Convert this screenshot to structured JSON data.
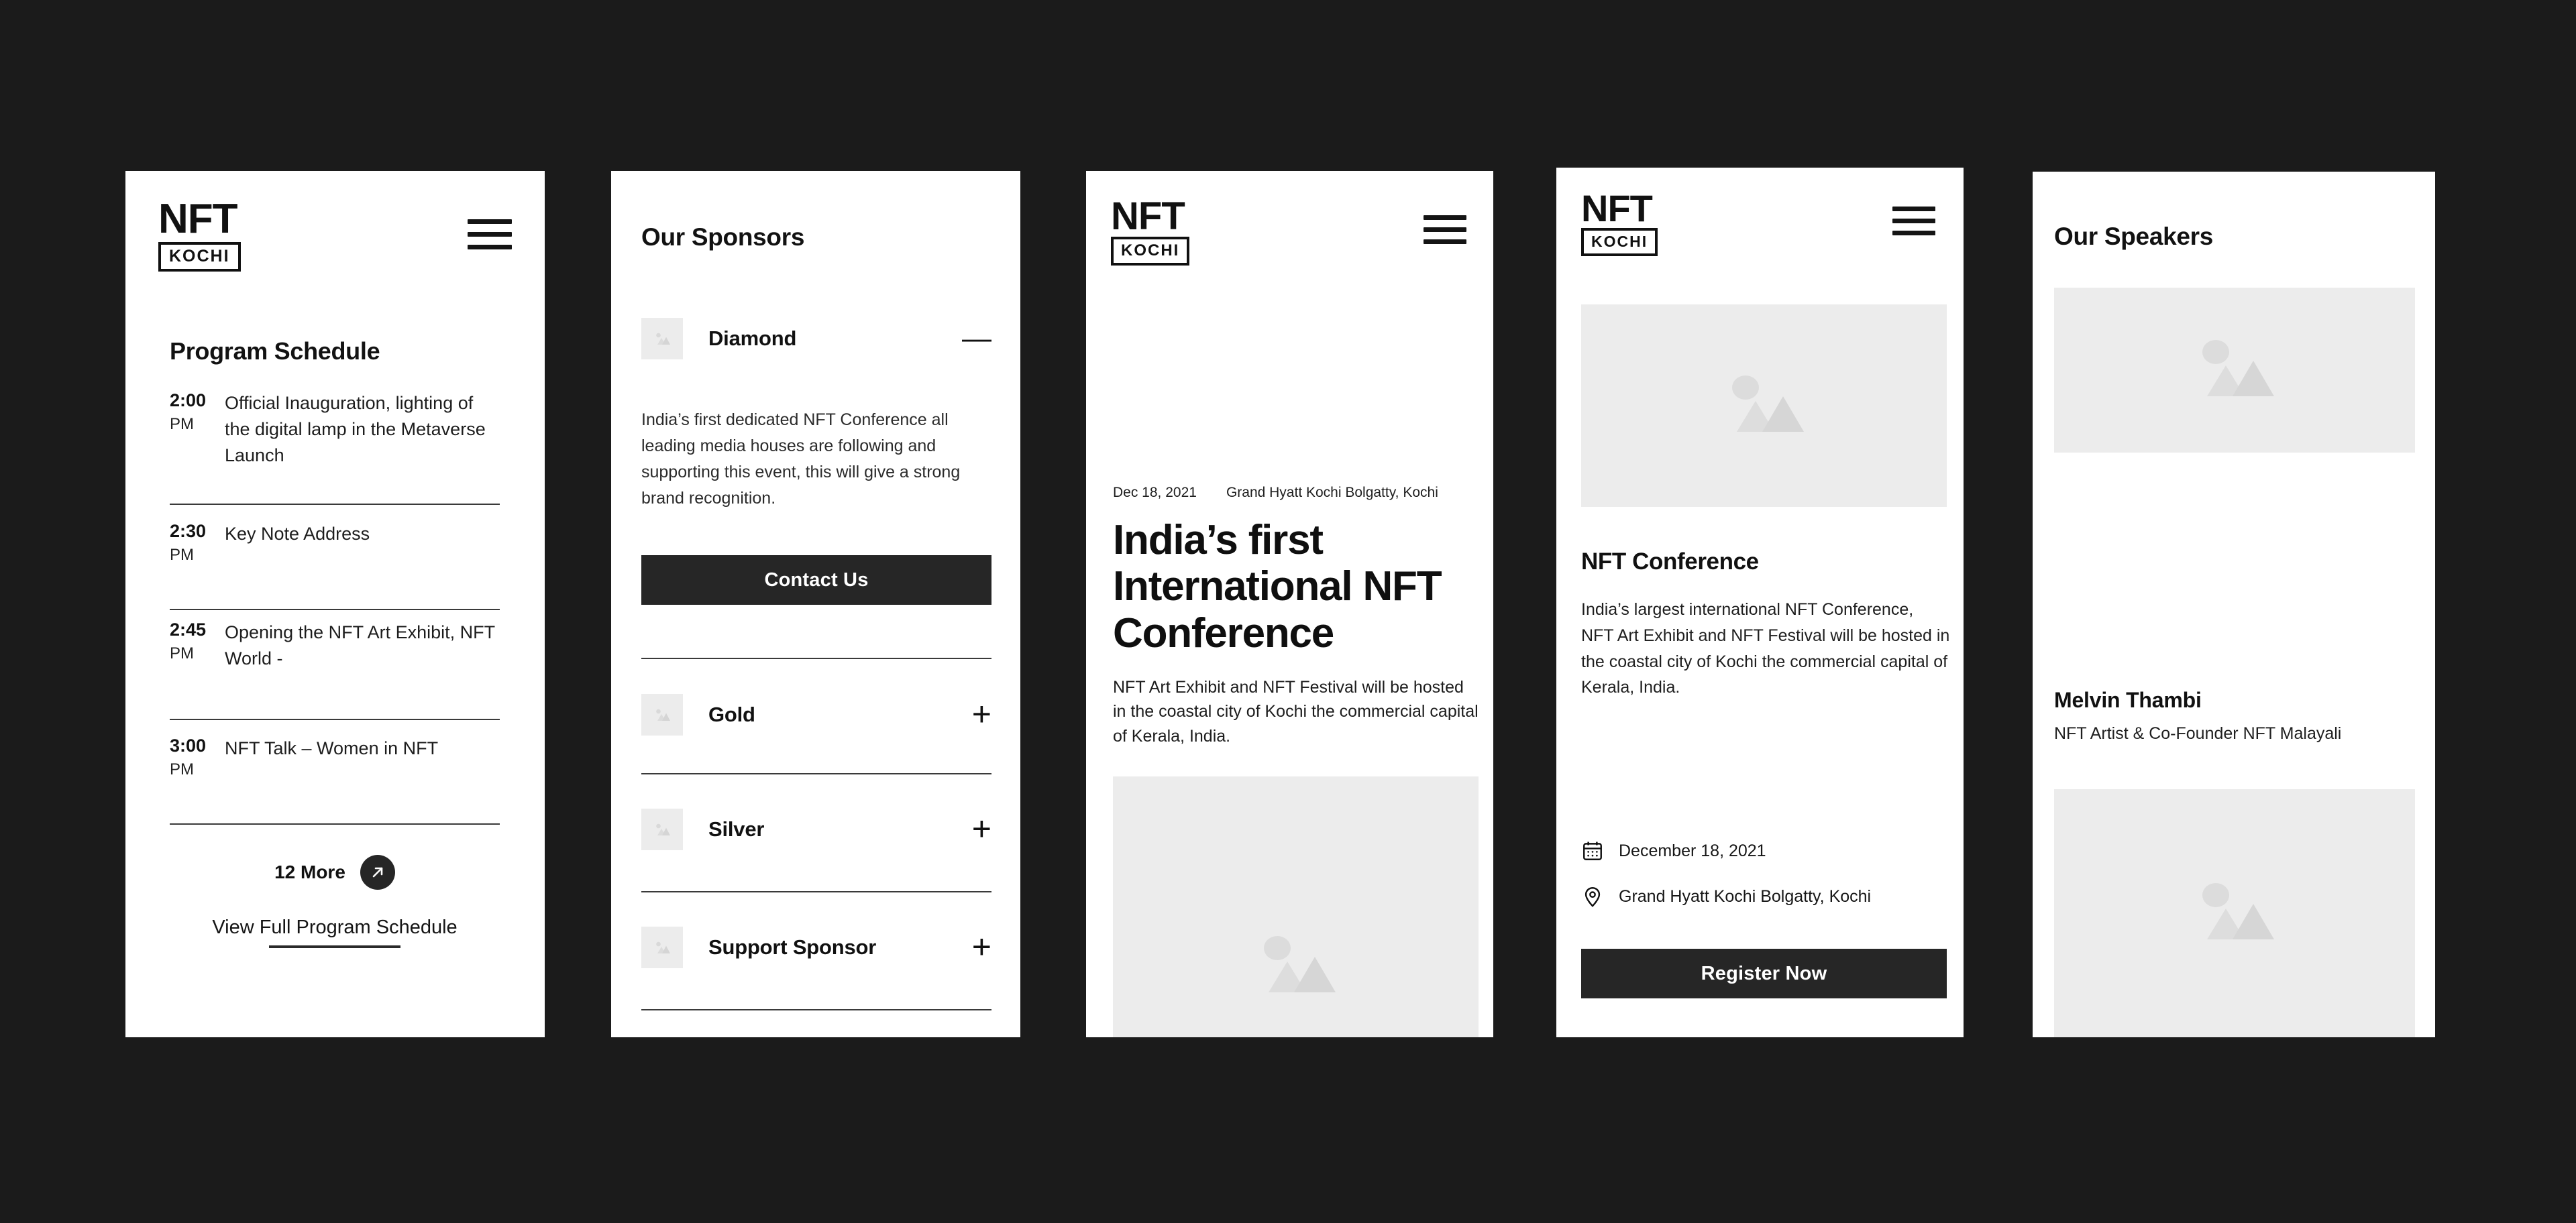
{
  "brand": {
    "nft": "NFT",
    "kochi": "KOCHI"
  },
  "icons": {
    "menu": "hamburger-menu-icon",
    "arrow": "arrow-up-right-icon",
    "calendar": "calendar-icon",
    "pin": "location-pin-icon",
    "image": "image-placeholder-icon",
    "minus": "minus-icon",
    "plus": "plus-icon"
  },
  "colors": {
    "page_background": "#1b1b1b",
    "panel_background": "#ffffff",
    "accent_dark": "#262626",
    "placeholder_grey": "#ececec",
    "divider": "#3a3a3a",
    "dot_inactive": "#c6c6c6",
    "dot_active": "#111111"
  },
  "panel_schedule": {
    "heading": "Program Schedule",
    "items": [
      {
        "time": "2:00",
        "ampm": "PM",
        "title": "Official Inauguration, lighting of the digital lamp in the Metaverse Launch"
      },
      {
        "time": "2:30",
        "ampm": "PM",
        "title": "Key Note Address"
      },
      {
        "time": "2:45",
        "ampm": "PM",
        "title": "Opening the NFT Art Exhibit, NFT World -"
      },
      {
        "time": "3:00",
        "ampm": "PM",
        "title": "NFT Talk – Women in NFT"
      }
    ],
    "more_label": "12 More",
    "view_full_label": "View Full Program Schedule"
  },
  "panel_sponsors": {
    "heading": "Our Sponsors",
    "tiers": [
      {
        "name": "Diamond",
        "sign": "—",
        "expanded": true,
        "description": "India’s first dedicated NFT Conference all leading media houses are following and supporting this event,  this will give a strong brand recognition.",
        "cta": "Contact Us"
      },
      {
        "name": "Gold",
        "sign": "+",
        "expanded": false
      },
      {
        "name": "Silver",
        "sign": "+",
        "expanded": false
      },
      {
        "name": "Support Sponsor",
        "sign": "+",
        "expanded": false
      }
    ]
  },
  "panel_hero": {
    "date": "Dec 18, 2021",
    "venue": "Grand Hyatt Kochi Bolgatty, Kochi",
    "title": "India’s first International NFT Conference",
    "subtitle": "NFT Art Exhibit and NFT Festival will be hosted in the coastal city of Kochi the commercial capital of Kerala, India.",
    "carousel": {
      "count": 4,
      "active_index": 1
    }
  },
  "panel_card": {
    "title": "NFT Conference",
    "body": "India’s largest international NFT Conference, NFT Art Exhibit and NFT Festival will be hosted in the coastal city of Kochi the commercial capital of Kerala, India.",
    "date": "December 18, 2021",
    "venue": "Grand Hyatt Kochi Bolgatty, Kochi",
    "cta": "Register Now"
  },
  "panel_speakers": {
    "heading": "Our Speakers",
    "speakers": [
      {
        "name": "Melvin Thambi",
        "role": "NFT Artist & Co-Founder NFT Malayali"
      },
      {
        "name": "",
        "role": ""
      }
    ]
  }
}
